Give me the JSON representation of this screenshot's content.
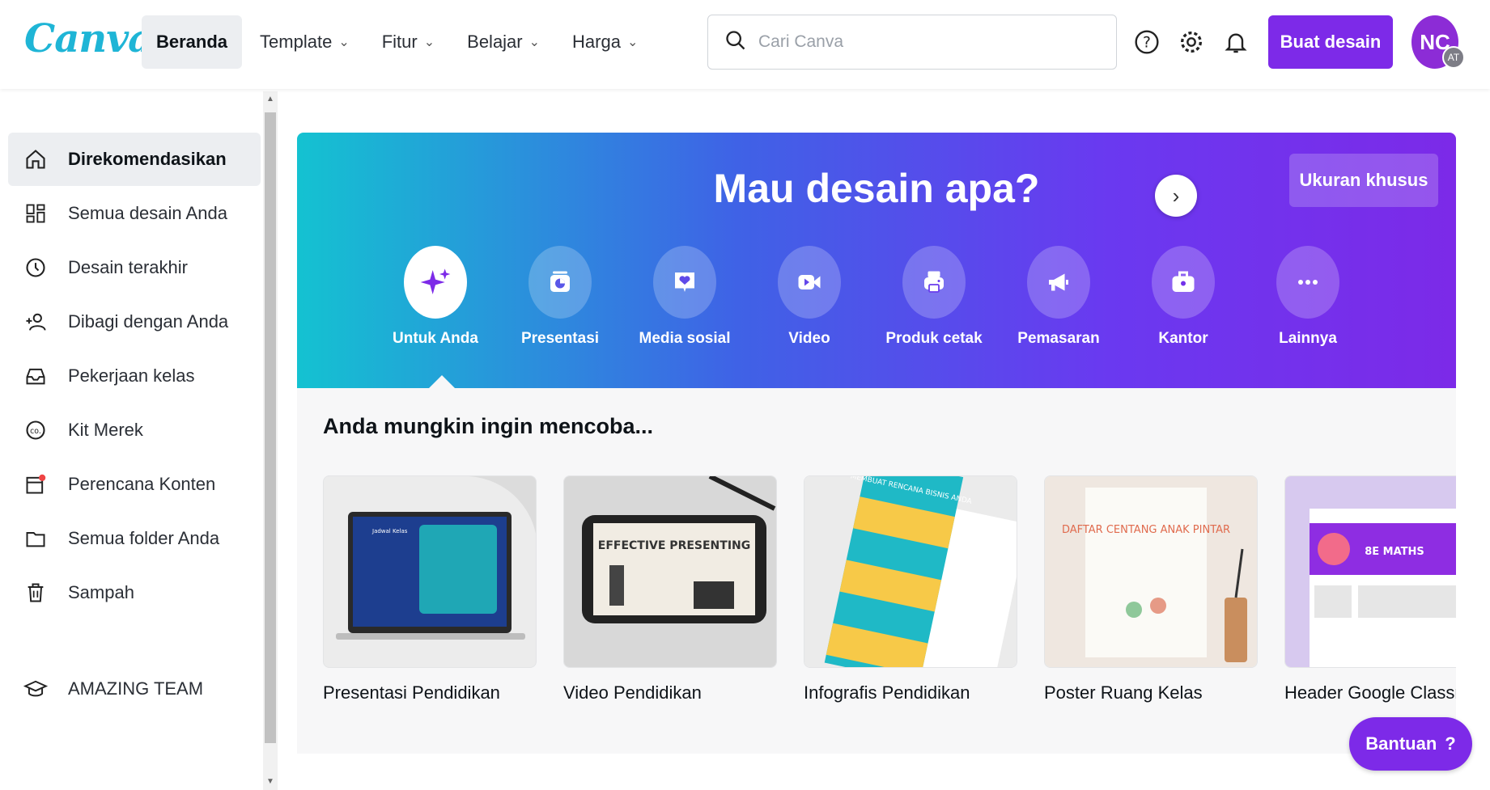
{
  "header": {
    "logo": "Canva",
    "nav": [
      {
        "label": "Beranda",
        "active": true,
        "dropdown": false
      },
      {
        "label": "Template",
        "dropdown": true
      },
      {
        "label": "Fitur",
        "dropdown": true
      },
      {
        "label": "Belajar",
        "dropdown": true
      },
      {
        "label": "Harga",
        "dropdown": true
      }
    ],
    "search_placeholder": "Cari Canva",
    "create_label": "Buat desain",
    "avatar_initials": "NC",
    "avatar_team": "AT",
    "icons": [
      "help-icon",
      "settings-icon",
      "bell-icon"
    ]
  },
  "sidebar": {
    "items": [
      {
        "label": "Direkomendasikan",
        "icon": "home-icon",
        "active": true
      },
      {
        "label": "Semua desain Anda",
        "icon": "grid-icon"
      },
      {
        "label": "Desain terakhir",
        "icon": "clock-icon"
      },
      {
        "label": "Dibagi dengan Anda",
        "icon": "people-icon"
      },
      {
        "label": "Pekerjaan kelas",
        "icon": "inbox-icon"
      },
      {
        "label": "Kit Merek",
        "icon": "brand-kit-icon"
      },
      {
        "label": "Perencana Konten",
        "icon": "calendar-icon"
      },
      {
        "label": "Semua folder Anda",
        "icon": "folder-icon"
      },
      {
        "label": "Sampah",
        "icon": "trash-icon"
      }
    ],
    "team": {
      "label": "AMAZING TEAM",
      "icon": "graduation-cap-icon"
    }
  },
  "hero": {
    "title": "Mau desain apa?",
    "custom_size": "Ukuran khusus",
    "categories": [
      {
        "label": "Untuk Anda",
        "icon": "sparkle-icon",
        "active": true
      },
      {
        "label": "Presentasi",
        "icon": "presentation-icon"
      },
      {
        "label": "Media sosial",
        "icon": "heart-chat-icon"
      },
      {
        "label": "Video",
        "icon": "video-icon"
      },
      {
        "label": "Produk cetak",
        "icon": "printer-icon"
      },
      {
        "label": "Pemasaran",
        "icon": "megaphone-icon"
      },
      {
        "label": "Kantor",
        "icon": "briefcase-icon"
      },
      {
        "label": "Lainnya",
        "icon": "more-icon"
      }
    ]
  },
  "suggestions": {
    "title": "Anda mungkin ingin mencoba...",
    "cards": [
      {
        "label": "Presentasi Pendidikan",
        "thumb_text": "Jadwal Kelas"
      },
      {
        "label": "Video Pendidikan",
        "thumb_text": "EFFECTIVE PRESENTING"
      },
      {
        "label": "Infografis Pendidikan",
        "thumb_text": "MEMBUAT RENCANA BISNIS ANDA"
      },
      {
        "label": "Poster Ruang Kelas",
        "thumb_text": "DAFTAR CENTANG ANAK PINTAR"
      },
      {
        "label": "Header Google Classro",
        "thumb_text": "8E MATHS"
      }
    ]
  },
  "help_label": "Bantuan",
  "help_mark": "?",
  "next_arrow": "›",
  "colors": {
    "brand": "#7d2ae8",
    "logo": "#1fb5d6",
    "hero_start": "#14c2d1",
    "hero_end": "#7c2ae8"
  }
}
